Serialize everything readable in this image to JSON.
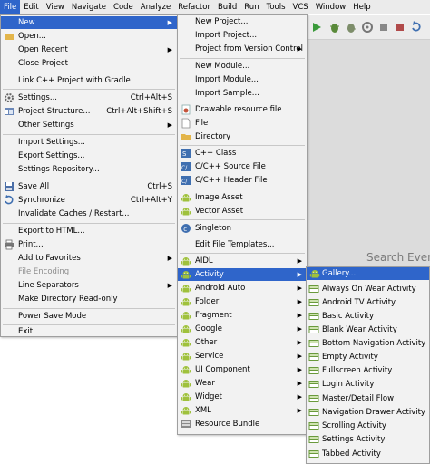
{
  "menubar": {
    "items": [
      "File",
      "Edit",
      "View",
      "Navigate",
      "Code",
      "Analyze",
      "Refactor",
      "Build",
      "Run",
      "Tools",
      "VCS",
      "Window",
      "Help"
    ]
  },
  "editor": {
    "search_hint": "Search Every"
  },
  "file_menu": {
    "new": "New",
    "open": "Open...",
    "open_recent": "Open Recent",
    "close_project": "Close Project",
    "link_cpp": "Link C++ Project with Gradle",
    "settings": "Settings...",
    "settings_shortcut": "Ctrl+Alt+S",
    "project_structure": "Project Structure...",
    "project_structure_shortcut": "Ctrl+Alt+Shift+S",
    "other_settings": "Other Settings",
    "import_settings": "Import Settings...",
    "export_settings": "Export Settings...",
    "settings_repository": "Settings Repository...",
    "save_all": "Save All",
    "save_all_shortcut": "Ctrl+S",
    "synchronize": "Synchronize",
    "synchronize_shortcut": "Ctrl+Alt+Y",
    "invalidate_caches": "Invalidate Caches / Restart...",
    "export_html": "Export to HTML...",
    "print": "Print...",
    "add_favorites": "Add to Favorites",
    "file_encoding": "File Encoding",
    "line_separators": "Line Separators",
    "make_read_only": "Make Directory Read-only",
    "power_save": "Power Save Mode",
    "exit": "Exit"
  },
  "new_menu": {
    "new_project": "New Project...",
    "import_project": "Import Project...",
    "project_from_vcs": "Project from Version Control",
    "new_module": "New Module...",
    "import_module": "Import Module...",
    "import_sample": "Import Sample...",
    "drawable_resource": "Drawable resource file",
    "file": "File",
    "directory": "Directory",
    "cpp_class": "C++ Class",
    "cpp_source": "C/C++ Source File",
    "cpp_header": "C/C++ Header File",
    "image_asset": "Image Asset",
    "vector_asset": "Vector Asset",
    "singleton": "Singleton",
    "edit_file_templates": "Edit File Templates...",
    "aidl": "AIDL",
    "activity": "Activity",
    "android_auto": "Android Auto",
    "folder": "Folder",
    "fragment": "Fragment",
    "google": "Google",
    "other": "Other",
    "service": "Service",
    "ui_component": "UI Component",
    "wear": "Wear",
    "widget": "Widget",
    "xml": "XML",
    "resource_bundle": "Resource Bundle"
  },
  "activity_menu": {
    "items": [
      "Gallery...",
      "Always On Wear Activity",
      "Android TV Activity",
      "Basic Activity",
      "Blank Wear Activity",
      "Bottom Navigation Activity",
      "Empty Activity",
      "Fullscreen Activity",
      "Login Activity",
      "Master/Detail Flow",
      "Navigation Drawer Activity",
      "Scrolling Activity",
      "Settings Activity",
      "Tabbed Activity"
    ]
  },
  "colors": {
    "selection": "#2f65ca",
    "menu_bg": "#f2f2f2",
    "android_green": "#9fc13c",
    "run_green": "#3a9a3a"
  },
  "icons": [
    "android-icon",
    "folder-icon",
    "file-icon",
    "cpp-icon",
    "save-icon",
    "sync-icon",
    "print-icon",
    "power-icon",
    "settings-icon"
  ]
}
